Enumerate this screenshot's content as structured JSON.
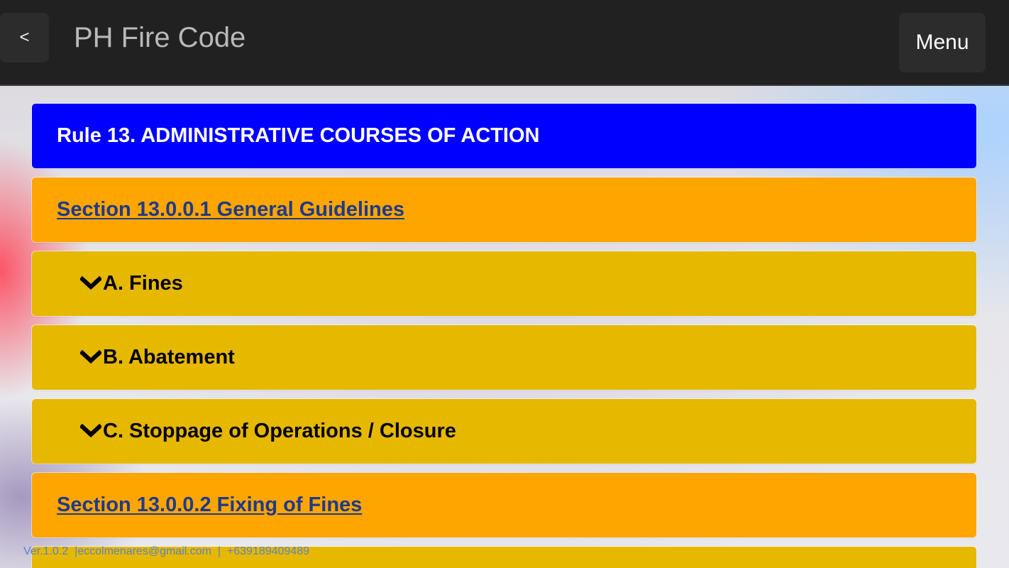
{
  "header": {
    "back_label": "<",
    "title": "PH Fire Code",
    "menu_label": "Menu"
  },
  "rule": {
    "title": "Rule 13. ADMINISTRATIVE COURSES OF ACTION"
  },
  "sections": [
    {
      "title": "Section 13.0.0.1 General Guidelines",
      "items": [
        {
          "label": "A. Fines"
        },
        {
          "label": "B. Abatement"
        },
        {
          "label": "C. Stoppage of Operations / Closure"
        }
      ]
    },
    {
      "title": "Section 13.0.0.2 Fixing of Fines"
    }
  ],
  "footer": {
    "version": "Ver.1.0.2",
    "email": "eccolmenares@gmail.com",
    "phone": "+639189409489",
    "separator": "|"
  },
  "colors": {
    "topbar": "#212121",
    "rule_bg": "#0000ff",
    "section_bg": "#ffa500",
    "item_bg": "#e6b800",
    "link": "#1e3a8a"
  },
  "icons": {
    "item_expand": "chevron-down-icon"
  }
}
